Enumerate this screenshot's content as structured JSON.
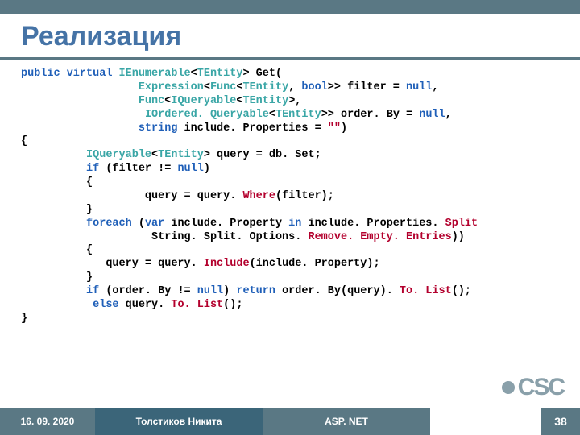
{
  "title": "Реализация",
  "code": {
    "l1a": "public virtual ",
    "l1b": "IEnumerable",
    "l1c": "<",
    "l1d": "TEntity",
    "l1e": "> Get(",
    "l2a": "                  ",
    "l2b": "Expression",
    "l2c": "<",
    "l2d": "Func",
    "l2e": "<",
    "l2f": "TEntity",
    "l2g": ", ",
    "l2h": "bool",
    "l2i": ">> filter = ",
    "l2j": "null",
    "l2k": ",",
    "l3a": "                  ",
    "l3b": "Func",
    "l3c": "<",
    "l3d": "IQueryable",
    "l3e": "<",
    "l3f": "TEntity",
    "l3g": ">,",
    "l4a": "                   ",
    "l4b": "IOrdered. Queryable",
    "l4c": "<",
    "l4d": "TEntity",
    "l4e": ">> order. By = ",
    "l4f": "null",
    "l4g": ",",
    "l5a": "                  ",
    "l5b": "string ",
    "l5c": "include. Properties = ",
    "l5d": "\"\"",
    "l5e": ")",
    "l6": "{",
    "l7a": "          ",
    "l7b": "IQueryable",
    "l7c": "<",
    "l7d": "TEntity",
    "l7e": "> query = db. Set;",
    "l8a": "          ",
    "l8b": "if ",
    "l8c": "(filter != ",
    "l8d": "null",
    "l8e": ")",
    "l9": "          {",
    "l10a": "                   query = query. ",
    "l10b": "Where",
    "l10c": "(filter);",
    "l11": "          }",
    "l12a": "          ",
    "l12b": "foreach ",
    "l12c": "(",
    "l12d": "var ",
    "l12e": "include. Property ",
    "l12f": "in ",
    "l12g": "include. Properties. ",
    "l12h": "Split",
    "l13a": "                    String. Split. Options. ",
    "l13b": "Remove. Empty. Entries",
    "l13c": "))",
    "l14": "          {",
    "l15a": "             query = query. ",
    "l15b": "Include",
    "l15c": "(include. Property);",
    "l16": "          }",
    "l17a": "          ",
    "l17b": "if ",
    "l17c": "(order. By != ",
    "l17d": "null",
    "l17e": ") ",
    "l17f": "return ",
    "l17g": "order. By(query). ",
    "l17h": "To. List",
    "l17i": "();",
    "l18a": "           ",
    "l18b": "else ",
    "l18c": "query. ",
    "l18d": "To. List",
    "l18e": "();",
    "l19": "}"
  },
  "footer": {
    "date": "16. 09. 2020",
    "author": "Толстиков Никита",
    "subject": "ASP. NET",
    "page": "38"
  },
  "logo": "CSC"
}
